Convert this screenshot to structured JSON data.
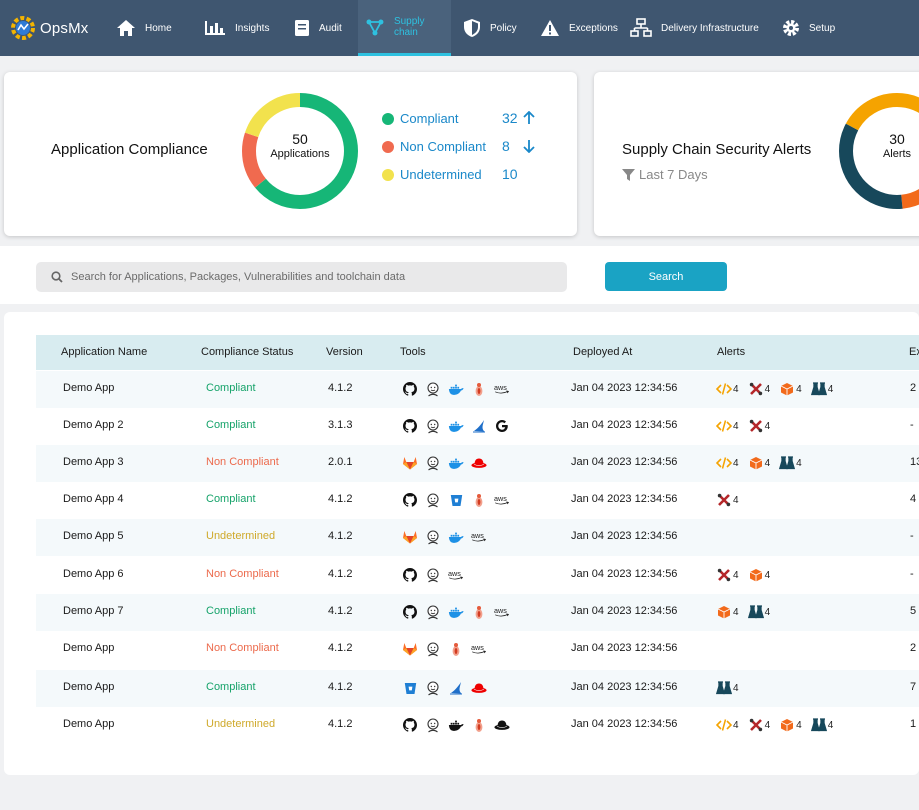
{
  "brand": {
    "name": "OpsMx"
  },
  "nav": {
    "items": [
      {
        "label": "Home",
        "icon": "home-icon"
      },
      {
        "label": "Insights",
        "icon": "insights-icon"
      },
      {
        "label": "Audit",
        "icon": "audit-icon"
      },
      {
        "label": "Supply chain",
        "icon": "supply-chain-icon",
        "active": true
      },
      {
        "label": "Policy",
        "icon": "policy-icon"
      },
      {
        "label": "Exceptions",
        "icon": "exceptions-icon"
      },
      {
        "label": "Delivery Infrastructure",
        "icon": "delivery-infrastructure-icon"
      },
      {
        "label": "Setup",
        "icon": "setup-icon"
      }
    ]
  },
  "compliance_card": {
    "title": "Application Compliance",
    "total": "50",
    "total_label": "Applications",
    "legend": [
      {
        "label": "Compliant",
        "count": "32",
        "trend": "up",
        "color": "#16b677"
      },
      {
        "label": "Non Compliant",
        "count": "8",
        "trend": "down",
        "color": "#f06a4f"
      },
      {
        "label": "Undetermined",
        "count": "10",
        "trend": "",
        "color": "#f2e24d"
      }
    ]
  },
  "alerts_card": {
    "title": "Supply Chain Security Alerts",
    "filter": "Last 7 Days",
    "total": "30",
    "total_label": "Alerts",
    "colors": [
      "#f5a300",
      "#f26a1b",
      "#17485b"
    ]
  },
  "search": {
    "placeholder": "Search for Applications, Packages, Vulnerabilities and toolchain data",
    "button": "Search"
  },
  "table": {
    "columns": [
      "Application Name",
      "Compliance Status",
      "Version",
      "Tools",
      "Deployed At",
      "Alerts",
      "Ex"
    ],
    "rows": [
      {
        "name": "Demo App",
        "status": "Compliant",
        "version": "4.1.2",
        "tools": [
          "github",
          "jenkins",
          "docker",
          "jfrog",
          "aws"
        ],
        "deployed": "Jan 04 2023 12:34:56",
        "alerts": [
          {
            "type": "code",
            "count": "4"
          },
          {
            "type": "tools",
            "count": "4"
          },
          {
            "type": "package",
            "count": "4"
          },
          {
            "type": "test",
            "count": "4"
          }
        ],
        "ex": "2"
      },
      {
        "name": "Demo App 2",
        "status": "Compliant",
        "version": "3.1.3",
        "tools": [
          "github",
          "jenkins",
          "docker",
          "bitbucket-sail",
          "google"
        ],
        "deployed": "Jan 04 2023 12:34:56",
        "alerts": [
          {
            "type": "code",
            "count": "4"
          },
          {
            "type": "tools",
            "count": "4"
          }
        ],
        "ex": "-"
      },
      {
        "name": "Demo App 3",
        "status": "Non Compliant",
        "version": "2.0.1",
        "tools": [
          "gitlab",
          "jenkins",
          "docker",
          "redhat"
        ],
        "deployed": "Jan 04 2023 12:34:56",
        "alerts": [
          {
            "type": "code",
            "count": "4"
          },
          {
            "type": "package",
            "count": "4"
          },
          {
            "type": "test",
            "count": "4"
          }
        ],
        "ex": "13"
      },
      {
        "name": "Demo App 4",
        "status": "Compliant",
        "version": "4.1.2",
        "tools": [
          "github",
          "jenkins",
          "bitbucket",
          "jfrog",
          "aws"
        ],
        "deployed": "Jan 04 2023 12:34:56",
        "alerts": [
          {
            "type": "tools",
            "count": "4"
          }
        ],
        "ex": "4"
      },
      {
        "name": "Demo App 5",
        "status": "Undetermined",
        "version": "4.1.2",
        "tools": [
          "gitlab",
          "jenkins",
          "docker",
          "aws"
        ],
        "deployed": "Jan 04 2023 12:34:56",
        "alerts": [],
        "ex": "-"
      },
      {
        "name": "Demo App 6",
        "status": "Non Compliant",
        "version": "4.1.2",
        "tools": [
          "github",
          "jenkins",
          "aws"
        ],
        "deployed": "Jan 04 2023 12:34:56",
        "alerts": [
          {
            "type": "tools",
            "count": "4"
          },
          {
            "type": "package",
            "count": "4"
          }
        ],
        "ex": "-"
      },
      {
        "name": "Demo App 7",
        "status": "Compliant",
        "version": "4.1.2",
        "tools": [
          "github",
          "jenkins",
          "docker",
          "jfrog",
          "aws"
        ],
        "deployed": "Jan 04 2023 12:34:56",
        "alerts": [
          {
            "type": "package",
            "count": "4"
          },
          {
            "type": "test",
            "count": "4"
          }
        ],
        "ex": "5"
      },
      {
        "name": "Demo App",
        "status": "Non Compliant",
        "version": "4.1.2",
        "tools": [
          "gitlab",
          "jenkins",
          "jfrog",
          "aws"
        ],
        "deployed": "Jan 04 2023 12:34:56",
        "alerts": [],
        "ex": "2"
      },
      {
        "name": "Demo App",
        "status": "Compliant",
        "version": "4.1.2",
        "tools": [
          "bitbucket",
          "jenkins",
          "bitbucket-sail",
          "redhat"
        ],
        "deployed": "Jan 04 2023 12:34:56",
        "alerts": [
          {
            "type": "test",
            "count": "4"
          }
        ],
        "ex": "7"
      },
      {
        "name": "Demo App",
        "status": "Undetermined",
        "version": "4.1.2",
        "tools": [
          "github",
          "jenkins",
          "docker-dark",
          "jfrog",
          "redhat-dark"
        ],
        "deployed": "Jan 04 2023 12:34:56",
        "alerts": [
          {
            "type": "code",
            "count": "4"
          },
          {
            "type": "tools",
            "count": "4"
          },
          {
            "type": "package",
            "count": "4"
          },
          {
            "type": "test",
            "count": "4"
          }
        ],
        "ex": "1"
      }
    ]
  }
}
